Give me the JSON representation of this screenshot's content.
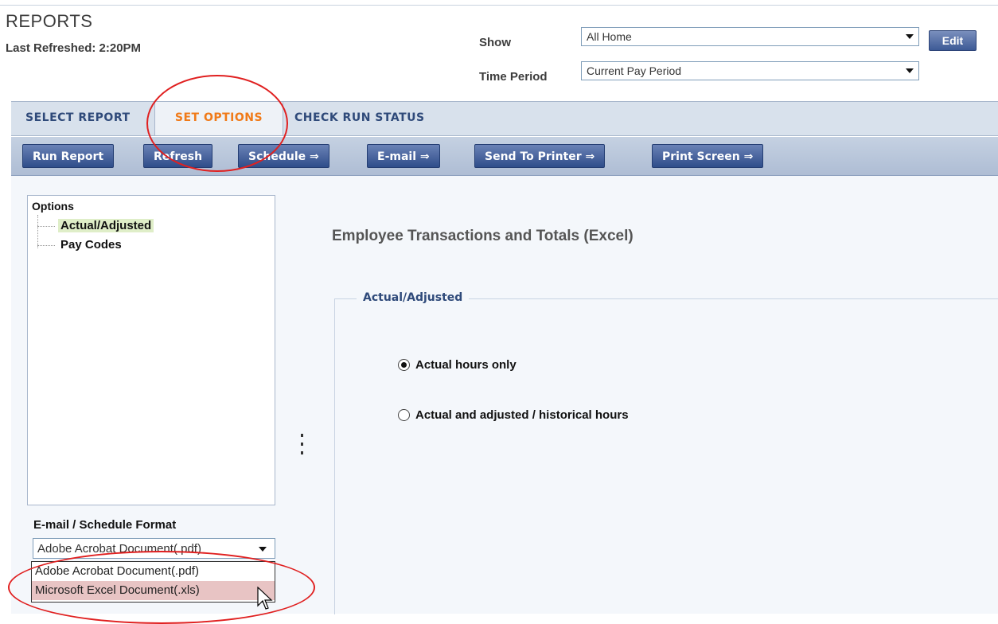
{
  "header": {
    "title": "REPORTS",
    "last_refreshed": "Last Refreshed: 2:20PM",
    "show_label": "Show",
    "show_value": "All Home",
    "edit_label": "Edit",
    "time_period_label": "Time Period",
    "time_period_value": "Current Pay Period"
  },
  "tabs": [
    {
      "label": "SELECT REPORT",
      "active": false
    },
    {
      "label": "SET OPTIONS",
      "active": true
    },
    {
      "label": "CHECK RUN STATUS",
      "active": false
    }
  ],
  "toolbar": {
    "run_report": "Run Report",
    "refresh": "Refresh",
    "schedule": "Schedule ⇒",
    "email": "E-mail ⇒",
    "send_to_printer": "Send To Printer ⇒",
    "print_screen": "Print Screen ⇒"
  },
  "tree": {
    "root": "Options",
    "items": [
      {
        "label": "Actual/Adjusted",
        "selected": true
      },
      {
        "label": "Pay Codes",
        "selected": false
      }
    ]
  },
  "format": {
    "label": "E-mail / Schedule Format",
    "selected": "Adobe Acrobat Document(.pdf)",
    "options": [
      "Adobe Acrobat Document(.pdf)",
      "Microsoft Excel Document(.xls)"
    ]
  },
  "content": {
    "report_title": "Employee Transactions and Totals (Excel)",
    "section_legend": "Actual/Adjusted",
    "radio_options": [
      {
        "label": "Actual hours only",
        "checked": true
      },
      {
        "label": "Actual and adjusted / historical hours",
        "checked": false
      }
    ]
  },
  "annotation_color": "#e02020"
}
